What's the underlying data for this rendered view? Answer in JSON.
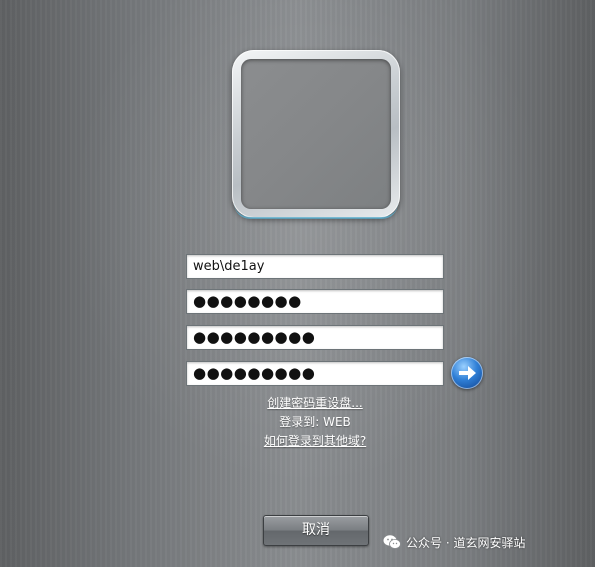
{
  "login": {
    "username": "web\\de1ay",
    "password_1": "●●●●●●●●",
    "password_2": "●●●●●●●●●",
    "password_3": "●●●●●●●●●"
  },
  "links": {
    "create_password_reset_disk": "创建密码重设盘...",
    "logon_to": "登录到: WEB",
    "how_to_logon_other_domain": "如何登录到其他域?"
  },
  "buttons": {
    "submit_icon": "arrow-right-icon",
    "cancel_label": "取消"
  },
  "watermark": {
    "text": "公众号 · 道玄网安驿站",
    "icon": "wechat-icon"
  },
  "colors": {
    "background": "#7a7d80",
    "submit_button": "#2f7fd6"
  }
}
